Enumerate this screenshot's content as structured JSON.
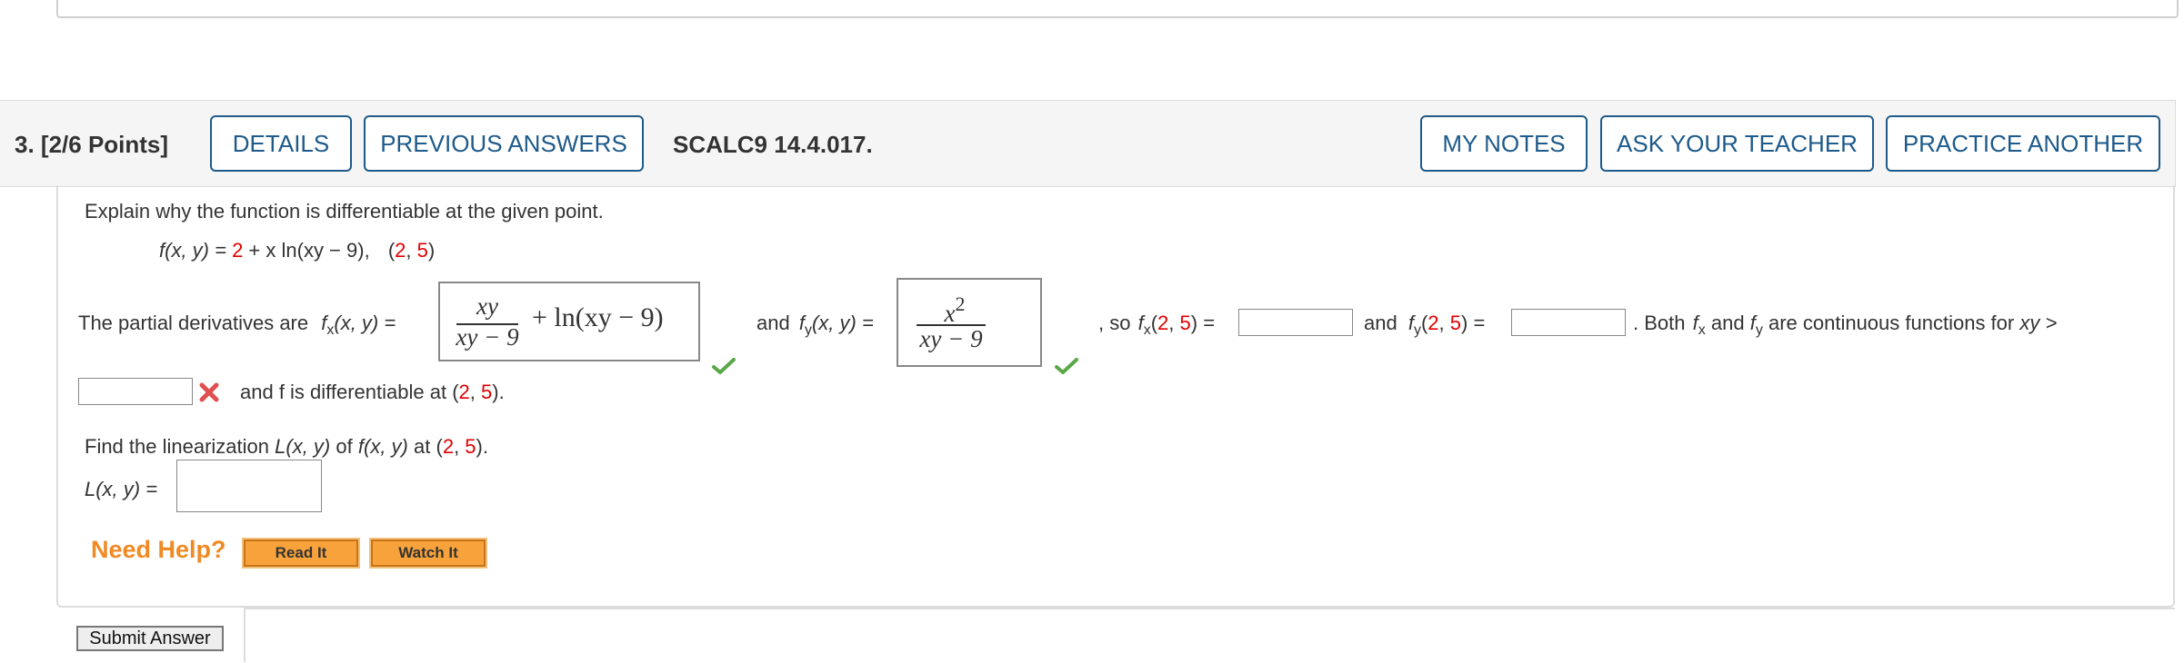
{
  "header": {
    "question_number": "3.",
    "points": "[2/6 Points]",
    "buttons": {
      "details": "DETAILS",
      "previous_answers": "PREVIOUS ANSWERS",
      "my_notes": "MY NOTES",
      "ask_teacher": "ASK YOUR TEACHER",
      "practice_another": "PRACTICE ANOTHER"
    },
    "problem_code": "SCALC9 14.4.017."
  },
  "problem": {
    "instruction": "Explain why the function is differentiable at the given point.",
    "function_lhs": "f(x, y) = ",
    "function_const": "2",
    "function_rest": " + x ln(xy − 9),",
    "point_open": "(",
    "point_x": "2",
    "point_sep": ", ",
    "point_y": "5",
    "point_close": ")"
  },
  "partials": {
    "intro": "The partial derivatives are",
    "fx_label": "f",
    "fx_sub": "x",
    "fx_args": "(x, y) =",
    "fx_answer": {
      "numerator": "xy",
      "denominator": "xy − 9",
      "rest": "+ ln(xy − 9)",
      "status": "correct"
    },
    "and_label": "and",
    "fy_label": "f",
    "fy_sub": "y",
    "fy_args": "(x, y) =",
    "fy_answer": {
      "numerator_base": "x",
      "numerator_exp": "2",
      "denominator": "xy − 9",
      "status": "correct"
    },
    "so_label": ", so",
    "fx_at": "(2, 5) =",
    "fx_at_value": "",
    "and2_label": "and",
    "fy_at": "(2, 5) =",
    "fy_at_value": "",
    "both_text": ". Both",
    "continuous_text": "are continuous functions for",
    "xy_gt": "xy >",
    "condition_value": "",
    "condition_status": "incorrect",
    "differentiable_text": "and f is differentiable at",
    "point_text_x": "2",
    "point_text_y": "5"
  },
  "linearization": {
    "prompt_a": "Find the linearization",
    "prompt_L": "L(x, y)",
    "prompt_b": "of",
    "prompt_f": "f(x, y)",
    "prompt_c": "at",
    "label": "L(x, y) =",
    "value": ""
  },
  "help": {
    "label": "Need Help?",
    "read_it": "Read It",
    "watch_it": "Watch It"
  },
  "submit_label": "Submit Answer",
  "colors": {
    "accent_blue": "#1e5a8a",
    "red_values": "#e00000",
    "help_orange": "#f08a24",
    "check_green": "#5aa84a"
  }
}
